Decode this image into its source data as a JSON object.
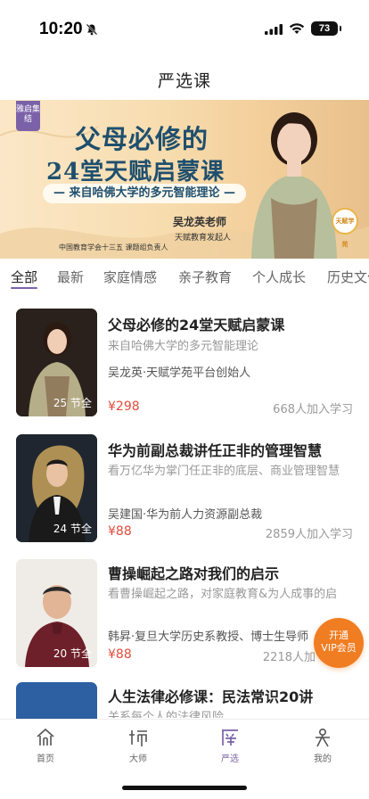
{
  "status_bar": {
    "time": "10:20",
    "battery": "73"
  },
  "nav": {
    "title": "严选课"
  },
  "banner": {
    "badge": "雅启集结",
    "title_line1": "父母必修的",
    "title_line2": "24堂天赋启蒙课",
    "subtitle": "— 来自哈佛大学的多元智能理论 —",
    "teacher": "吴龙英老师",
    "teacher_role": "天赋教育发起人",
    "org": "中国教育学会十三五 课题组负责人",
    "logo": "天赋学苑"
  },
  "tabs": [
    {
      "label": "全部",
      "active": true
    },
    {
      "label": "最新",
      "active": false
    },
    {
      "label": "家庭情感",
      "active": false
    },
    {
      "label": "亲子教育",
      "active": false
    },
    {
      "label": "个人成长",
      "active": false
    },
    {
      "label": "历史文化",
      "active": false
    }
  ],
  "courses": [
    {
      "title": "父母必修的24堂天赋启蒙课",
      "desc": "来自哈佛大学的多元智能理论",
      "teacher": "吴龙英·天赋学苑平台创始人",
      "lessons": "25 节全",
      "price": "¥298",
      "joined": "668人加入学习"
    },
    {
      "title": "华为前副总裁讲任正非的管理智慧",
      "desc": "看万亿华为掌门任正非的底层、商业管理智慧",
      "teacher": "吴建国·华为前人力资源副总裁",
      "lessons": "24 节全",
      "price": "¥88",
      "joined": "2859人加入学习"
    },
    {
      "title": "曹操崛起之路对我们的启示",
      "desc": "看曹操崛起之路，对家庭教育&为人成事的启",
      "teacher": "韩昇·复旦大学历史系教授、博士生导师",
      "lessons": "20 节全",
      "price": "¥88",
      "joined": "2218人加"
    },
    {
      "title": "人生法律必修课：民法常识20讲",
      "desc": "关系每个人的法律风险",
      "teacher": "",
      "lessons": "",
      "price": "",
      "joined": ""
    }
  ],
  "vip": {
    "line1": "开通",
    "line2": "VIP会员"
  },
  "tabbar": [
    {
      "label": "首页",
      "icon": "home-icon",
      "active": false
    },
    {
      "label": "大师",
      "icon": "master-icon",
      "active": false
    },
    {
      "label": "严选",
      "icon": "select-icon",
      "active": true
    },
    {
      "label": "我的",
      "icon": "profile-icon",
      "active": false
    }
  ],
  "colors": {
    "accent": "#7b62a8",
    "price": "#e14b3c",
    "vip": "#f07d22",
    "banner_title": "#1f4f6e"
  }
}
